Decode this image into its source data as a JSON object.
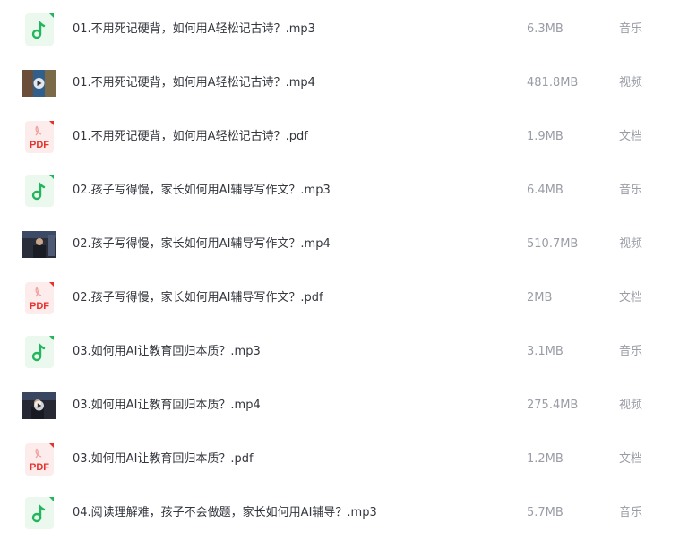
{
  "colors": {
    "audio_icon_bg": "#eaf8ee",
    "audio_icon_fg": "#22b65c",
    "pdf_icon_bg": "#fdecec",
    "pdf_icon_fg": "#e5322d",
    "video_thumb_bg": "#2a2d3a"
  },
  "files": [
    {
      "icon": "music-note-icon",
      "name": "01.不用死记硬背，如何用A轻松记古诗？.mp3",
      "size": "6.3MB",
      "type": "音乐"
    },
    {
      "icon": "video-thumbnail-icon",
      "name": "01.不用死记硬背，如何用A轻松记古诗？.mp4",
      "size": "481.8MB",
      "type": "视频"
    },
    {
      "icon": "pdf-icon",
      "name": "01.不用死记硬背，如何用A轻松记古诗？.pdf",
      "size": "1.9MB",
      "type": "文档"
    },
    {
      "icon": "music-note-icon",
      "name": "02.孩子写得慢，家长如何用AI辅导写作文？.mp3",
      "size": "6.4MB",
      "type": "音乐"
    },
    {
      "icon": "video-thumbnail-icon",
      "name": "02.孩子写得慢，家长如何用AI辅导写作文？.mp4",
      "size": "510.7MB",
      "type": "视频"
    },
    {
      "icon": "pdf-icon",
      "name": "02.孩子写得慢，家长如何用AI辅导写作文？.pdf",
      "size": "2MB",
      "type": "文档"
    },
    {
      "icon": "music-note-icon",
      "name": "03.如何用AI让教育回归本质？.mp3",
      "size": "3.1MB",
      "type": "音乐"
    },
    {
      "icon": "video-thumbnail-icon",
      "name": "03.如何用AI让教育回归本质？.mp4",
      "size": "275.4MB",
      "type": "视频"
    },
    {
      "icon": "pdf-icon",
      "name": "03.如何用AI让教育回归本质？.pdf",
      "size": "1.2MB",
      "type": "文档"
    },
    {
      "icon": "music-note-icon",
      "name": "04.阅读理解难，孩子不会做题，家长如何用AI辅导？.mp3",
      "size": "5.7MB",
      "type": "音乐"
    }
  ],
  "pdf_badge": "PDF"
}
